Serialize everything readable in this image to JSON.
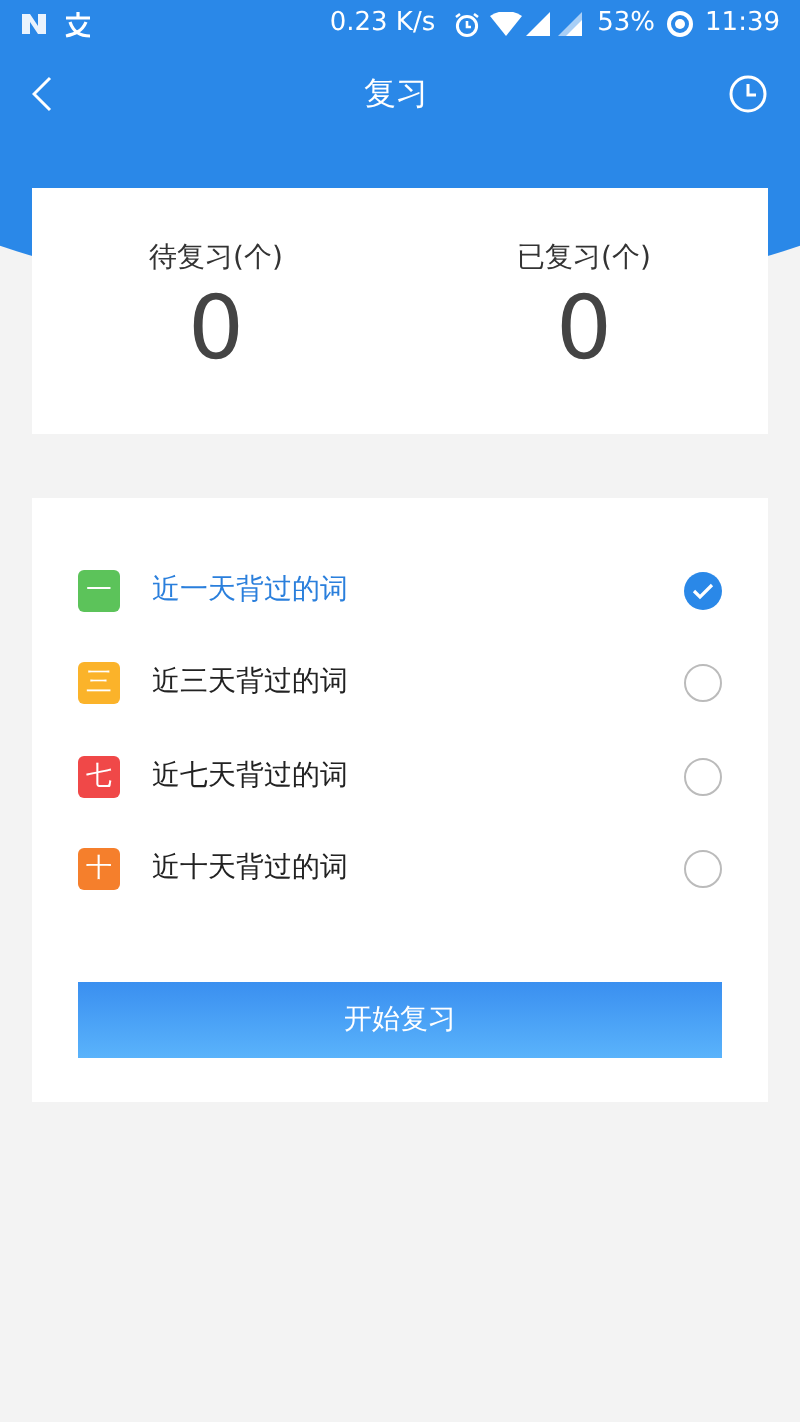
{
  "status_bar": {
    "speed": "0.23 K/s",
    "battery": "53%",
    "time": "11:39"
  },
  "header": {
    "title": "复习"
  },
  "stats": [
    {
      "label": "待复习(个)",
      "value": "0"
    },
    {
      "label": "已复习(个)",
      "value": "0"
    }
  ],
  "options": [
    {
      "badge": "一",
      "label": "近一天背过的词",
      "color": "#5cc35a",
      "selected": true
    },
    {
      "badge": "三",
      "label": "近三天背过的词",
      "color": "#fbb32a",
      "selected": false
    },
    {
      "badge": "七",
      "label": "近七天背过的词",
      "color": "#f04848",
      "selected": false
    },
    {
      "badge": "十",
      "label": "近十天背过的词",
      "color": "#f57f2c",
      "selected": false
    }
  ],
  "start_button": "开始复习"
}
